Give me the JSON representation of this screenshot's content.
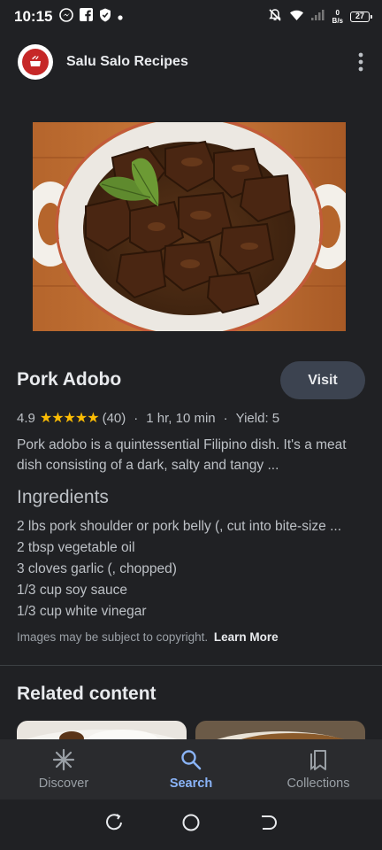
{
  "status_bar": {
    "time": "10:15",
    "net_speed_value": "0",
    "net_speed_unit": "B/s",
    "battery": "27"
  },
  "header": {
    "source_name": "Salu Salo Recipes"
  },
  "recipe": {
    "title": "Pork Adobo",
    "visit_label": "Visit",
    "rating": "4.9",
    "stars": "★★★★★",
    "review_count": "(40)",
    "time": "1 hr, 10 min",
    "yield": "Yield: 5",
    "description": "Pork adobo is a quintessential Filipino dish. It's a meat dish consisting of a dark, salty and tangy ..."
  },
  "ingredients": {
    "heading": "Ingredients",
    "items": [
      "2 lbs pork shoulder or pork belly (, cut into bite-size ...",
      "2 tbsp vegetable oil",
      "3 cloves garlic (, chopped)",
      "1/3 cup soy sauce",
      "1/3 cup white vinegar"
    ]
  },
  "copyright": {
    "text": "Images may be subject to copyright.",
    "link": "Learn More"
  },
  "related": {
    "heading": "Related content"
  },
  "bottom_nav": [
    {
      "label": "Discover",
      "icon": "asterisk-icon",
      "active": false
    },
    {
      "label": "Search",
      "icon": "search-icon",
      "active": true
    },
    {
      "label": "Collections",
      "icon": "collections-icon",
      "active": false
    }
  ],
  "colors": {
    "background": "#202124",
    "accent": "#8ab4f8",
    "star": "#fbbc04",
    "visit_button": "#3c4350"
  }
}
